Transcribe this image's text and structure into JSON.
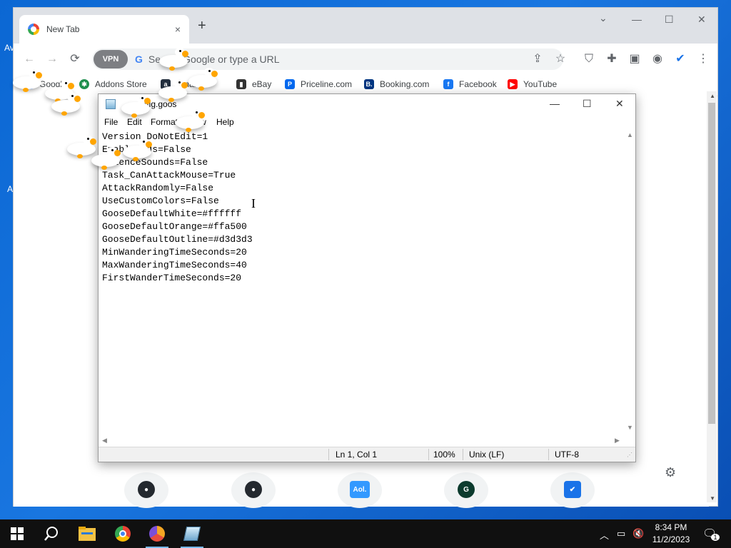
{
  "desktop": {
    "fragments": [
      "Av",
      "A"
    ]
  },
  "browser": {
    "tab": {
      "title": "New Tab",
      "favicon": "browser-logo-icon",
      "close": "×"
    },
    "new_tab": "+",
    "window_controls": {
      "dropdown": "⌄",
      "minimize": "—",
      "maximize": "☐",
      "close": "✕"
    },
    "toolbar": {
      "back": "←",
      "forward": "→",
      "reload": "⟳"
    },
    "omnibox": {
      "vpn_label": "VPN",
      "engine_icon": "G",
      "placeholder": "Search Google or type a URL"
    },
    "extensions": [
      "share-icon",
      "star-icon",
      "shield-icon",
      "puzzle-icon",
      "sidebar-icon",
      "profile-icon",
      "security-check-icon",
      "menu-icon"
    ],
    "bookmarks": [
      {
        "label": "Google",
        "icon_text": "G",
        "color": "#4285f4"
      },
      {
        "label": "Addons Store",
        "icon_text": "✱",
        "color": "#1f8f4e"
      },
      {
        "label": "Amazon.",
        "icon_text": "a",
        "color": "#232f3e"
      },
      {
        "label": "eBay",
        "icon_text": "▮",
        "color": "#333333"
      },
      {
        "label": "Priceline.com",
        "icon_text": "P",
        "color": "#0068ef"
      },
      {
        "label": "Booking.com",
        "icon_text": "B.",
        "color": "#003580"
      },
      {
        "label": "Facebook",
        "icon_text": "f",
        "color": "#1877f2"
      },
      {
        "label": "YouTube",
        "icon_text": "▶",
        "color": "#ff0000"
      }
    ],
    "shortcuts": [
      {
        "name": "github",
        "icon_text": "●",
        "color": "#24292f"
      },
      {
        "name": "github",
        "icon_text": "●",
        "color": "#24292f"
      },
      {
        "name": "aol",
        "icon_text": "Aol.",
        "color": "#39f"
      },
      {
        "name": "grammarly",
        "icon_text": "G",
        "color": "#0c3b2e"
      },
      {
        "name": "shield",
        "icon_text": "✔",
        "color": "#1a73e8"
      }
    ]
  },
  "notepad": {
    "title": "config.goos",
    "controls": {
      "minimize": "—",
      "maximize": "☐",
      "close": "✕"
    },
    "menu": [
      "File",
      "Edit",
      "Format",
      "View",
      "Help"
    ],
    "content": "Version_DoNotEdit=1\nEnableMods=False\nSilenceSounds=False\nTask_CanAttackMouse=True\nAttackRandomly=False\nUseCustomColors=False\nGooseDefaultWhite=#ffffff\nGooseDefaultOrange=#ffa500\nGooseDefaultOutline=#d3d3d3\nMinWanderingTimeSeconds=20\nMaxWanderingTimeSeconds=40\nFirstWanderTimeSeconds=20",
    "status": {
      "position": "Ln 1, Col 1",
      "zoom": "100%",
      "line_ending": "Unix (LF)",
      "encoding": "UTF-8"
    }
  },
  "taskbar": {
    "apps": [
      "windows-start-icon",
      "search-icon",
      "file-explorer-icon",
      "chrome-icon",
      "brave-icon",
      "notepad-icon"
    ],
    "tray": {
      "time": "8:34 PM",
      "date": "11/2/2023",
      "notifications": "1"
    }
  },
  "colors": {
    "desktop_blue": "#0b67d3",
    "goose_orange": "#ffa500",
    "goose_white": "#ffffff"
  }
}
